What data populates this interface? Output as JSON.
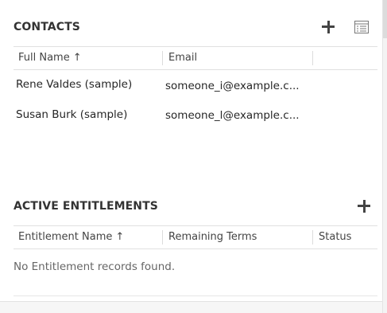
{
  "contacts": {
    "title": "CONTACTS",
    "add_icon": "plus-icon",
    "view_icon": "grid-view-icon",
    "columns": [
      {
        "label": "Full Name",
        "sort": "ascending"
      },
      {
        "label": "Email"
      }
    ],
    "rows": [
      {
        "full_name": "Rene Valdes (sample)",
        "email": "someone_i@example.c..."
      },
      {
        "full_name": "Susan Burk (sample)",
        "email": "someone_l@example.c..."
      }
    ]
  },
  "entitlements": {
    "title": "ACTIVE ENTITLEMENTS",
    "add_icon": "plus-icon",
    "columns": [
      {
        "label": "Entitlement Name",
        "sort": "ascending"
      },
      {
        "label": "Remaining Terms"
      },
      {
        "label": "Status"
      }
    ],
    "empty_message": "No Entitlement records found."
  },
  "icons": {
    "sort_ascending": "↑"
  }
}
